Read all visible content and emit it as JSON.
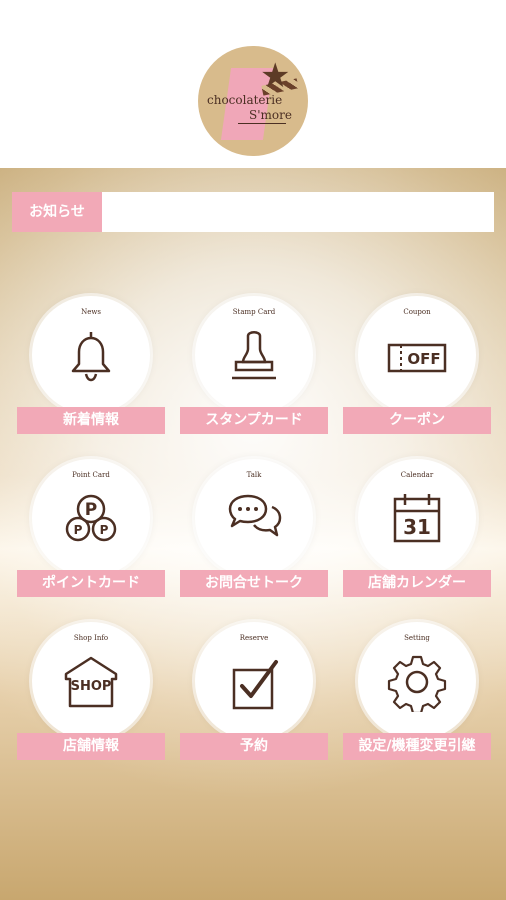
{
  "header": {
    "logo_line1": "chocolaterie",
    "logo_line2": "S'more"
  },
  "notice": {
    "label": "お知らせ",
    "value": ""
  },
  "menu": [
    {
      "small": "News",
      "label": "新着情報",
      "icon": "bell-icon"
    },
    {
      "small": "Stamp Card",
      "label": "スタンプカード",
      "icon": "stamp-icon"
    },
    {
      "small": "Coupon",
      "label": "クーポン",
      "icon": "coupon-icon",
      "icon_text": "OFF"
    },
    {
      "small": "Point Card",
      "label": "ポイントカード",
      "icon": "points-icon",
      "icon_text": "P"
    },
    {
      "small": "Talk",
      "label": "お問合せトーク",
      "icon": "chat-icon"
    },
    {
      "small": "Calendar",
      "label": "店舗カレンダー",
      "icon": "calendar-icon",
      "icon_text": "31"
    },
    {
      "small": "Shop Info",
      "label": "店舗情報",
      "icon": "shop-icon",
      "icon_text": "SHOP"
    },
    {
      "small": "Reserve",
      "label": "予約",
      "icon": "reserve-icon"
    },
    {
      "small": "Setting",
      "label": "設定/機種変更引継",
      "icon": "gear-icon"
    }
  ],
  "colors": {
    "pink": "#f2a9b7",
    "brown": "#4b2f23",
    "gold": "#d8bb8c"
  }
}
